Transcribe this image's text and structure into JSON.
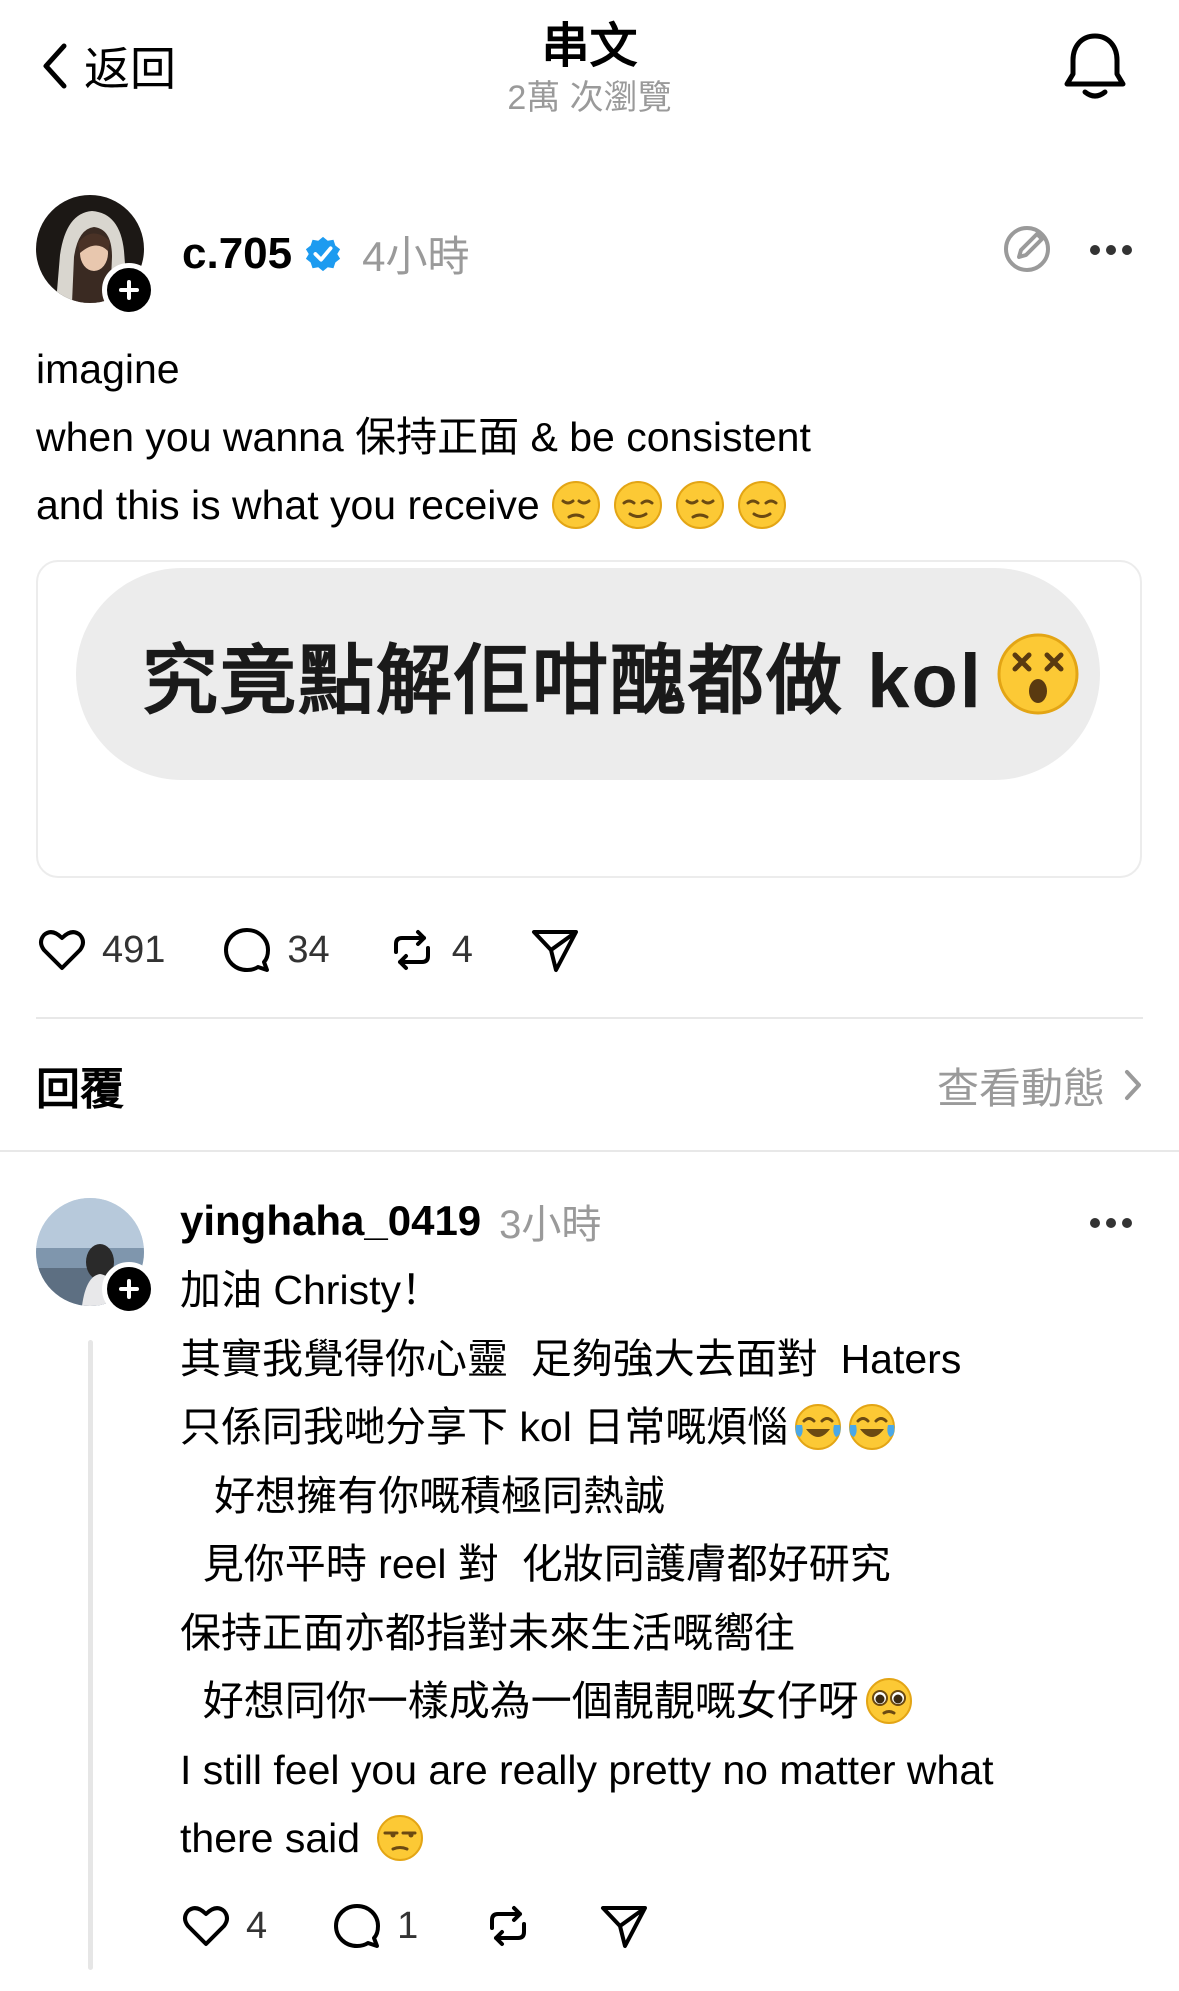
{
  "header": {
    "back_label": "返回",
    "title": "串文",
    "subtitle": "2萬 次瀏覽"
  },
  "post": {
    "username": "c.705",
    "time": "4小時",
    "lines": [
      "imagine",
      "when you wanna 保持正面 & be consistent",
      "and this is what you receive"
    ],
    "image_text": "究竟點解佢咁醜都做 kol",
    "likes": "491",
    "comments": "34",
    "reposts": "4"
  },
  "replies_section": {
    "title": "回覆",
    "view_activity": "查看動態"
  },
  "reply": {
    "username": "yinghaha_0419",
    "time": "3小時",
    "lines": [
      "加油 Christy！",
      "其實我覺得你心靈  足夠強大去面對  Haters",
      "只係同我哋分享下 kol 日常嘅煩惱",
      "   好想擁有你嘅積極同熱誠",
      "  見你平時 reel 對  化妝同護膚都好研究",
      "保持正面亦都指對未來生活嘅嚮往",
      "  好想同你一樣成為一個靚靚嘅女仔呀",
      "I still feel you are really pretty no matter what",
      "there said"
    ],
    "likes": "4",
    "comments": "1"
  },
  "colors": {
    "verified_blue": "#1d9bf0",
    "muted_gray": "#9a9a9a",
    "bubble_gray": "#ececec"
  },
  "icons": [
    "back-chevron-icon",
    "bell-icon",
    "verified-icon",
    "edit-icon",
    "more-icon",
    "heart-icon",
    "comment-icon",
    "repost-icon",
    "share-icon",
    "chevron-right-icon",
    "emoji-icon"
  ]
}
